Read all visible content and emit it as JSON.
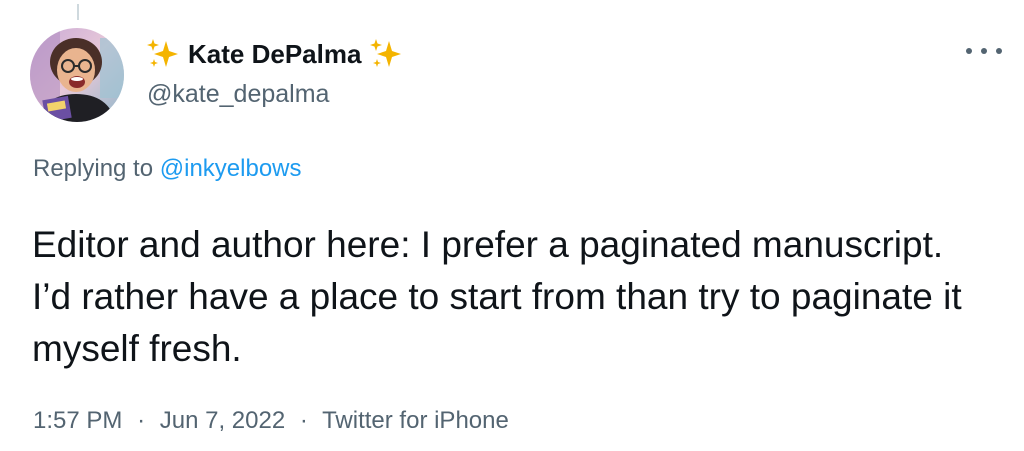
{
  "author": {
    "display_name": "Kate DePalma",
    "handle": "@kate_depalma",
    "avatar_icon": "profile-photo",
    "name_emoji_icon": "sparkles-icon"
  },
  "reply": {
    "prefix": "Replying to",
    "mention": "@inkyelbows"
  },
  "tweet": {
    "text": "Editor and author here: I prefer a paginated manuscript. I’d rather have a place to start from than try to paginate it myself fresh.",
    "time": "1:57 PM",
    "date": "Jun 7, 2022",
    "source": "Twitter for iPhone",
    "separator": "·"
  },
  "actions": {
    "more_icon": "more-options-icon"
  },
  "colors": {
    "text_primary": "#0f1419",
    "text_secondary": "#536471",
    "link": "#1d9bf0",
    "sparkle": "#f4b400"
  }
}
